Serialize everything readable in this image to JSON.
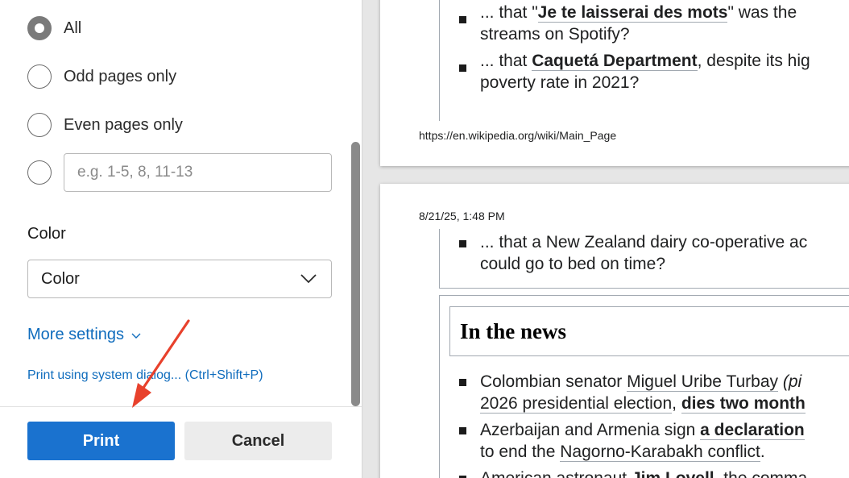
{
  "print_panel": {
    "pages": {
      "options": [
        {
          "label": "All",
          "checked": true
        },
        {
          "label": "Odd pages only",
          "checked": false
        },
        {
          "label": "Even pages only",
          "checked": false
        }
      ],
      "custom_range_placeholder": "e.g. 1-5, 8, 11-13"
    },
    "color": {
      "label": "Color",
      "selected": "Color"
    },
    "more_settings_label": "More settings",
    "system_dialog_label": "Print using system dialog... (Ctrl+Shift+P)",
    "print_button_label": "Print",
    "cancel_button_label": "Cancel",
    "annotation_arrow_color": "#e8412c",
    "accent_color": "#1a72cf"
  },
  "preview": {
    "page1": {
      "items": [
        {
          "lines": [
            "... that \"Je te laisserai des mots\" was the",
            "streams on Spotify?"
          ]
        },
        {
          "lines": [
            "... that Caquetá Department, despite its hig",
            "poverty rate in 2021?"
          ]
        }
      ],
      "footer_url": "https://en.wikipedia.org/wiki/Main_Page"
    },
    "page2": {
      "header_date": "8/21/25, 1:48 PM",
      "dyk_item": [
        "... that a New Zealand dairy co-operative ac",
        "could go to bed on time?"
      ],
      "news_heading": "In the news",
      "news_items": [
        [
          "Colombian senator Miguel Uribe Turbay (pi",
          "2026 presidential election, dies two month"
        ],
        [
          "Azerbaijan and Armenia sign a declaration",
          "to end the Nagorno-Karabakh conflict."
        ],
        [
          "American astronaut Jim Lovell, the comma"
        ]
      ]
    }
  }
}
